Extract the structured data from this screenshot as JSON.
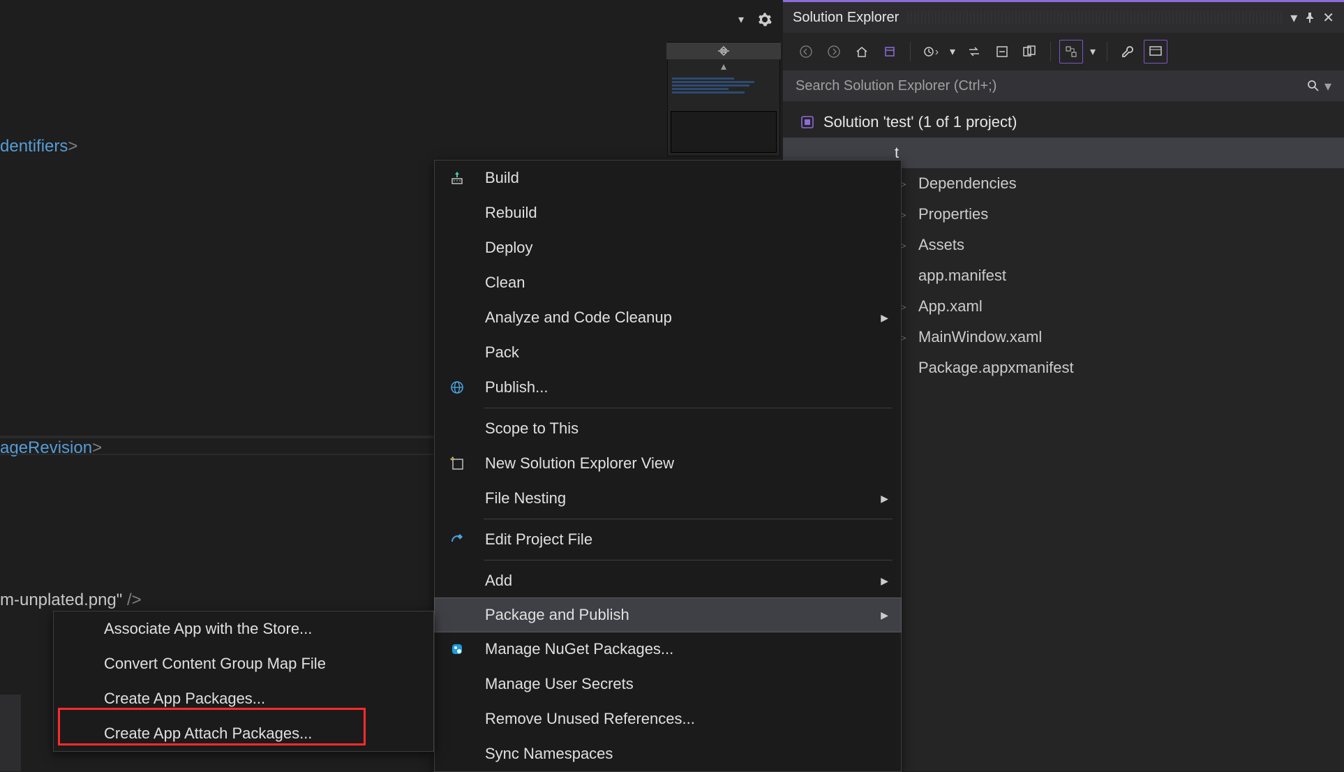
{
  "editor": {
    "code_lines": [
      {
        "pre": "dentifiers",
        "angle": ">"
      },
      {
        "pre": "ageRevision",
        "angle": ">"
      },
      {
        "text": "m-unplated.png\"",
        "end": " />"
      }
    ]
  },
  "editor_toolbar": {
    "dropdown_icon": "▾",
    "settings_icon": "⚙"
  },
  "solution_explorer": {
    "title": "Solution Explorer",
    "search_placeholder": "Search Solution Explorer (Ctrl+;)",
    "root": "Solution 'test' (1 of 1 project)",
    "project_tail": "t",
    "items": [
      "Dependencies",
      "Properties",
      "Assets",
      "app.manifest",
      "App.xaml",
      "MainWindow.xaml",
      "Package.appxmanifest"
    ],
    "title_controls": {
      "dropdown": "▾",
      "pin": "📌",
      "close": "✕"
    }
  },
  "context_menu": {
    "items": [
      {
        "label": "Build",
        "icon": "build"
      },
      {
        "label": "Rebuild"
      },
      {
        "label": "Deploy"
      },
      {
        "label": "Clean"
      },
      {
        "label": "Analyze and Code Cleanup",
        "submenu": true
      },
      {
        "label": "Pack"
      },
      {
        "label": "Publish...",
        "icon": "globe"
      },
      {
        "sep": true
      },
      {
        "label": "Scope to This"
      },
      {
        "label": "New Solution Explorer View",
        "icon": "newview"
      },
      {
        "label": "File Nesting",
        "submenu": true
      },
      {
        "sep": true
      },
      {
        "label": "Edit Project File",
        "icon": "edit"
      },
      {
        "sep": true
      },
      {
        "label": "Add",
        "submenu": true
      },
      {
        "label": "Package and Publish",
        "submenu": true,
        "hover": true
      },
      {
        "label": "Manage NuGet Packages...",
        "icon": "nuget"
      },
      {
        "label": "Manage User Secrets"
      },
      {
        "label": "Remove Unused References..."
      },
      {
        "label": "Sync Namespaces"
      }
    ]
  },
  "submenu": {
    "items": [
      "Associate App with the Store...",
      "Convert Content Group Map File",
      "Create App Packages...",
      "Create App Attach Packages..."
    ]
  }
}
